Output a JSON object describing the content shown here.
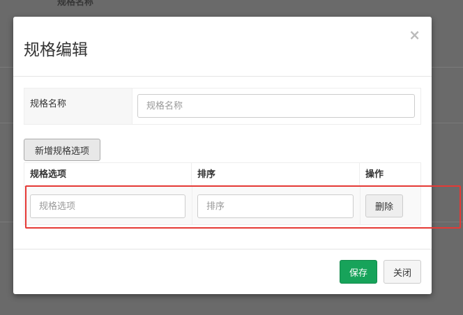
{
  "background": {
    "partial_text": "规格名称"
  },
  "modal": {
    "title": "规格编辑",
    "close_glyph": "×",
    "name_field": {
      "label": "规格名称",
      "placeholder": "规格名称",
      "value": ""
    },
    "add_option_label": "新增规格选项",
    "options_table": {
      "headers": [
        "规格选项",
        "排序",
        "操作"
      ],
      "rows": [
        {
          "option_placeholder": "规格选项",
          "sort_placeholder": "排序",
          "delete_label": "删除"
        }
      ]
    },
    "footer": {
      "save_label": "保存",
      "close_label": "关闭"
    }
  },
  "colors": {
    "save_button": "#17a35a",
    "highlight_box": "#e53935",
    "backdrop": "#6a6a6a"
  }
}
